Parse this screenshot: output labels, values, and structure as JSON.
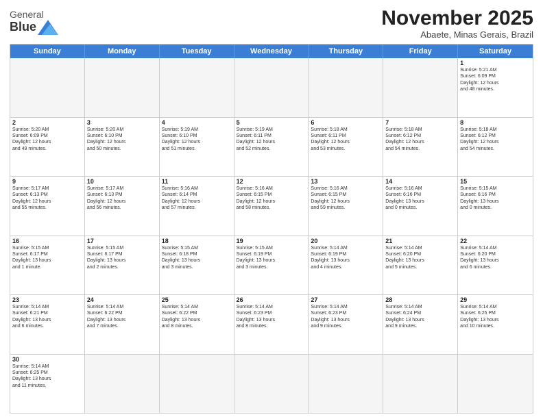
{
  "header": {
    "logo_general": "General",
    "logo_blue": "Blue",
    "month_title": "November 2025",
    "location": "Abaete, Minas Gerais, Brazil"
  },
  "days_of_week": [
    "Sunday",
    "Monday",
    "Tuesday",
    "Wednesday",
    "Thursday",
    "Friday",
    "Saturday"
  ],
  "weeks": [
    [
      {
        "day": "",
        "info": ""
      },
      {
        "day": "",
        "info": ""
      },
      {
        "day": "",
        "info": ""
      },
      {
        "day": "",
        "info": ""
      },
      {
        "day": "",
        "info": ""
      },
      {
        "day": "",
        "info": ""
      },
      {
        "day": "1",
        "info": "Sunrise: 5:21 AM\nSunset: 6:09 PM\nDaylight: 12 hours\nand 48 minutes."
      }
    ],
    [
      {
        "day": "2",
        "info": "Sunrise: 5:20 AM\nSunset: 6:09 PM\nDaylight: 12 hours\nand 49 minutes."
      },
      {
        "day": "3",
        "info": "Sunrise: 5:20 AM\nSunset: 6:10 PM\nDaylight: 12 hours\nand 50 minutes."
      },
      {
        "day": "4",
        "info": "Sunrise: 5:19 AM\nSunset: 6:10 PM\nDaylight: 12 hours\nand 51 minutes."
      },
      {
        "day": "5",
        "info": "Sunrise: 5:19 AM\nSunset: 6:11 PM\nDaylight: 12 hours\nand 52 minutes."
      },
      {
        "day": "6",
        "info": "Sunrise: 5:18 AM\nSunset: 6:11 PM\nDaylight: 12 hours\nand 53 minutes."
      },
      {
        "day": "7",
        "info": "Sunrise: 5:18 AM\nSunset: 6:12 PM\nDaylight: 12 hours\nand 54 minutes."
      },
      {
        "day": "8",
        "info": "Sunrise: 5:18 AM\nSunset: 6:12 PM\nDaylight: 12 hours\nand 54 minutes."
      }
    ],
    [
      {
        "day": "9",
        "info": "Sunrise: 5:17 AM\nSunset: 6:13 PM\nDaylight: 12 hours\nand 55 minutes."
      },
      {
        "day": "10",
        "info": "Sunrise: 5:17 AM\nSunset: 6:13 PM\nDaylight: 12 hours\nand 56 minutes."
      },
      {
        "day": "11",
        "info": "Sunrise: 5:16 AM\nSunset: 6:14 PM\nDaylight: 12 hours\nand 57 minutes."
      },
      {
        "day": "12",
        "info": "Sunrise: 5:16 AM\nSunset: 6:15 PM\nDaylight: 12 hours\nand 58 minutes."
      },
      {
        "day": "13",
        "info": "Sunrise: 5:16 AM\nSunset: 6:15 PM\nDaylight: 12 hours\nand 59 minutes."
      },
      {
        "day": "14",
        "info": "Sunrise: 5:16 AM\nSunset: 6:16 PM\nDaylight: 13 hours\nand 0 minutes."
      },
      {
        "day": "15",
        "info": "Sunrise: 5:15 AM\nSunset: 6:16 PM\nDaylight: 13 hours\nand 0 minutes."
      }
    ],
    [
      {
        "day": "16",
        "info": "Sunrise: 5:15 AM\nSunset: 6:17 PM\nDaylight: 13 hours\nand 1 minute."
      },
      {
        "day": "17",
        "info": "Sunrise: 5:15 AM\nSunset: 6:17 PM\nDaylight: 13 hours\nand 2 minutes."
      },
      {
        "day": "18",
        "info": "Sunrise: 5:15 AM\nSunset: 6:18 PM\nDaylight: 13 hours\nand 3 minutes."
      },
      {
        "day": "19",
        "info": "Sunrise: 5:15 AM\nSunset: 6:19 PM\nDaylight: 13 hours\nand 3 minutes."
      },
      {
        "day": "20",
        "info": "Sunrise: 5:14 AM\nSunset: 6:19 PM\nDaylight: 13 hours\nand 4 minutes."
      },
      {
        "day": "21",
        "info": "Sunrise: 5:14 AM\nSunset: 6:20 PM\nDaylight: 13 hours\nand 5 minutes."
      },
      {
        "day": "22",
        "info": "Sunrise: 5:14 AM\nSunset: 6:20 PM\nDaylight: 13 hours\nand 6 minutes."
      }
    ],
    [
      {
        "day": "23",
        "info": "Sunrise: 5:14 AM\nSunset: 6:21 PM\nDaylight: 13 hours\nand 6 minutes."
      },
      {
        "day": "24",
        "info": "Sunrise: 5:14 AM\nSunset: 6:22 PM\nDaylight: 13 hours\nand 7 minutes."
      },
      {
        "day": "25",
        "info": "Sunrise: 5:14 AM\nSunset: 6:22 PM\nDaylight: 13 hours\nand 8 minutes."
      },
      {
        "day": "26",
        "info": "Sunrise: 5:14 AM\nSunset: 6:23 PM\nDaylight: 13 hours\nand 8 minutes."
      },
      {
        "day": "27",
        "info": "Sunrise: 5:14 AM\nSunset: 6:23 PM\nDaylight: 13 hours\nand 9 minutes."
      },
      {
        "day": "28",
        "info": "Sunrise: 5:14 AM\nSunset: 6:24 PM\nDaylight: 13 hours\nand 9 minutes."
      },
      {
        "day": "29",
        "info": "Sunrise: 5:14 AM\nSunset: 6:25 PM\nDaylight: 13 hours\nand 10 minutes."
      }
    ],
    [
      {
        "day": "30",
        "info": "Sunrise: 5:14 AM\nSunset: 6:25 PM\nDaylight: 13 hours\nand 11 minutes."
      },
      {
        "day": "",
        "info": ""
      },
      {
        "day": "",
        "info": ""
      },
      {
        "day": "",
        "info": ""
      },
      {
        "day": "",
        "info": ""
      },
      {
        "day": "",
        "info": ""
      },
      {
        "day": "",
        "info": ""
      }
    ]
  ]
}
